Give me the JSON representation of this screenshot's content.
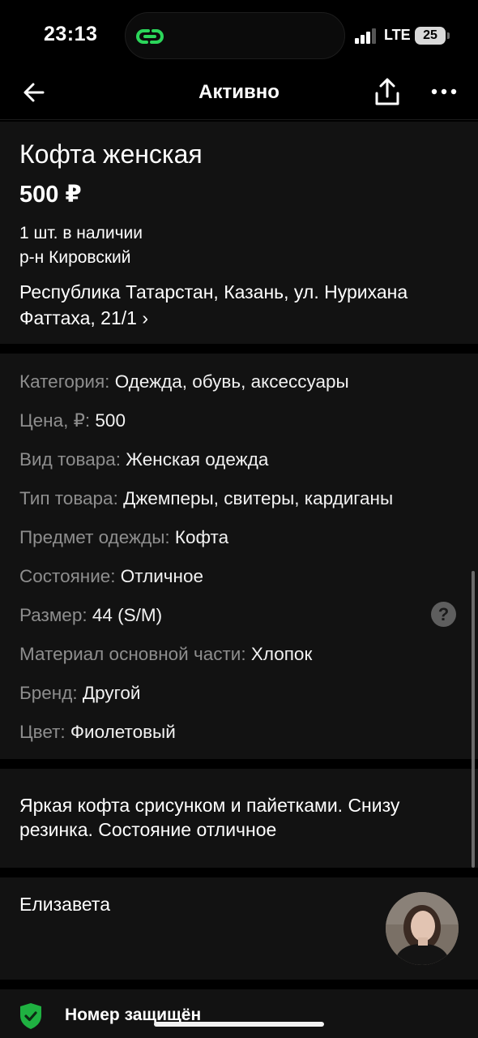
{
  "status": {
    "time": "23:13",
    "network": "LTE",
    "battery": "25"
  },
  "nav": {
    "title": "Активно",
    "back_icon": "arrow-left-icon",
    "share_icon": "share-icon",
    "more_icon": "more-horizontal-icon"
  },
  "product": {
    "title": "Кофта женская",
    "price": "500 ₽",
    "stock": "1 шт. в наличии",
    "district": "р-н Кировский",
    "address_line1": "Республика Татарстан, Казань, ул. Нурихана",
    "address_line2": "Фаттаха, 21/1 ›"
  },
  "params": [
    {
      "label": "Категория:",
      "value": " Одежда, обувь, аксессуары"
    },
    {
      "label": "Цена, ₽:",
      "value": " 500"
    },
    {
      "label": "Вид товара:",
      "value": " Женская одежда"
    },
    {
      "label": "Тип товара:",
      "value": " Джемперы, свитеры, кардиганы"
    },
    {
      "label": "Предмет одежды:",
      "value": " Кофта"
    },
    {
      "label": "Состояние:",
      "value": " Отличное"
    },
    {
      "label": "Размер:",
      "value": " 44 (S/M)"
    },
    {
      "label": "Материал основной части:",
      "value": " Хлопок"
    },
    {
      "label": "Бренд:",
      "value": " Другой"
    },
    {
      "label": "Цвет:",
      "value": " Фиолетовый"
    }
  ],
  "help": {
    "symbol": "?"
  },
  "description": {
    "line1": "Яркая кофта срисунком и пайетками. Снизу",
    "line2": "резинка. Состояние отличное"
  },
  "seller": {
    "name": "Елизавета"
  },
  "security": {
    "label": "Номер защищён"
  },
  "colors": {
    "background": "#000000",
    "surface": "#121212",
    "label_gray": "#8e8e8e",
    "shield_green": "#1fb141",
    "island_green": "#2bd65a"
  }
}
